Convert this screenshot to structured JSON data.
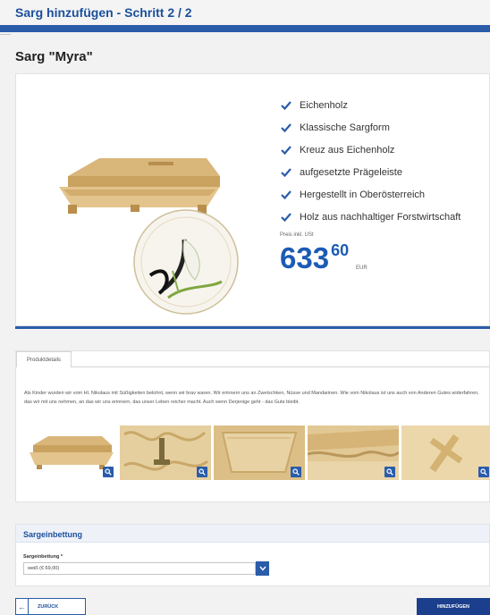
{
  "header": {
    "title": "Sarg hinzufügen - Schritt 2 / 2"
  },
  "product": {
    "title": "Sarg \"Myra\"",
    "features": [
      "Eichenholz",
      "Klassische Sargform",
      "Kreuz aus Eichenholz",
      "aufgesetzte Prägeleiste",
      "Hergestellt in Oberösterreich",
      "Holz aus nachhaltiger Forstwirtschaft"
    ],
    "price_label": "Preis inkl. USt",
    "price_int": "633",
    "price_dec": "60",
    "currency": "EUR"
  },
  "details": {
    "tab_label": "Produktdetails",
    "description": "Als Kinder wurden wir vom Hl. Nikolaus mit Süßigkeiten belohnt, wenn wir brav waren. Wir erinnern uns an Zwetschken, Nüsse und Mandarinen. Wie vom Nikolaus ist uns auch von Anderen Gutes widerfahren, das wir mit uns nehmen, an das wir uns erinnern, das unser Leben reicher macht. Auch wenn Derjenige geht - das Gute bleibt."
  },
  "config": {
    "section_title": "Sargeinbettung",
    "select_label": "Sargeinbettung *",
    "select_value": "weiß (€ 69,00)"
  },
  "actions": {
    "back_label": "ZURÜCK",
    "add_label": "HINZUFÜGEN"
  },
  "colors": {
    "brand_blue": "#2a5caa",
    "price_blue": "#1b5bb5",
    "button_dark": "#1b3f8c"
  },
  "icons": {
    "feature_check": "check-icon",
    "zoom": "zoom-icon",
    "select_arrow": "chevron-down-icon",
    "back": "arrow-left-icon"
  }
}
